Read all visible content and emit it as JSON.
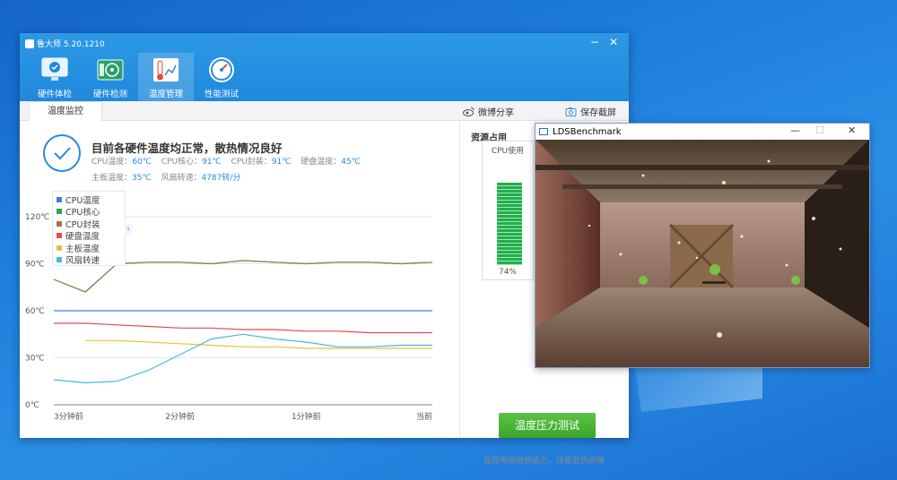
{
  "app": {
    "title": "鲁大师 5.20.1210",
    "minimize": "−",
    "close": "✕",
    "nav": [
      {
        "label": "硬件体检",
        "icon": "monitor-check-icon"
      },
      {
        "label": "硬件检测",
        "icon": "board-icon"
      },
      {
        "label": "温度管理",
        "icon": "thermometer-icon"
      },
      {
        "label": "性能测试",
        "icon": "speedometer-icon"
      }
    ],
    "tab": "温度监控",
    "share": "微博分享",
    "screenshot": "保存截屏",
    "status": {
      "headline": "目前各硬件温度均正常，散热情况良好",
      "cpu_temp_label": "CPU温度：",
      "cpu_temp": "60℃",
      "cpu_core_label": "CPU核心：",
      "cpu_core": "91℃",
      "cpu_pkg_label": "CPU封装：",
      "cpu_pkg": "91℃",
      "disk_label": "硬盘温度：",
      "disk": "45℃",
      "board_label": "主板温度：",
      "board": "35℃",
      "fan_label": "风扇转速：",
      "fan": "4787转/分"
    },
    "resources_title": "资源占用",
    "cpu_usage_label": "CPU使用",
    "cpu_usage_pct": "74%",
    "cpu_usage_value": 0.74,
    "stress_button": "温度压力测试",
    "footer_note": "监控电脑散热能力，排查散热故障"
  },
  "chart_data": {
    "type": "line",
    "y_ticks": [
      "120℃",
      "90℃",
      "60℃",
      "30℃",
      "0℃"
    ],
    "x_ticks": [
      "3分钟前",
      "2分钟前",
      "1分钟前",
      "当前"
    ],
    "ylim": [
      0,
      120
    ],
    "series": [
      {
        "name": "CPU温度",
        "color": "#3d7fd6",
        "values": [
          60,
          60,
          60,
          60,
          60,
          60,
          60,
          60,
          60,
          60,
          60,
          60,
          60
        ]
      },
      {
        "name": "CPU核心",
        "color": "#2aa84a",
        "values": [
          80,
          72,
          90,
          91,
          91,
          90,
          92,
          91,
          90,
          91,
          91,
          90,
          91
        ]
      },
      {
        "name": "CPU封装",
        "color": "#a0784a",
        "values": [
          80,
          72,
          90,
          91,
          91,
          90,
          92,
          91,
          90,
          91,
          91,
          90,
          91
        ]
      },
      {
        "name": "硬盘温度",
        "color": "#e84a4a",
        "values": [
          52,
          52,
          51,
          50,
          49,
          49,
          48,
          48,
          47,
          47,
          46,
          46,
          46
        ]
      },
      {
        "name": "主板温度",
        "color": "#e8c23a",
        "values": [
          null,
          41,
          41,
          40,
          39,
          38,
          37,
          37,
          36,
          36,
          36,
          36,
          36
        ]
      },
      {
        "name": "风扇转速",
        "color": "#4ab4e8",
        "values": [
          16,
          14,
          15,
          22,
          32,
          42,
          45,
          42,
          40,
          37,
          37,
          38,
          38
        ]
      }
    ]
  },
  "bench": {
    "title": "LDSBenchmark",
    "minimize": "—",
    "maximize": "☐",
    "close": "✕"
  }
}
